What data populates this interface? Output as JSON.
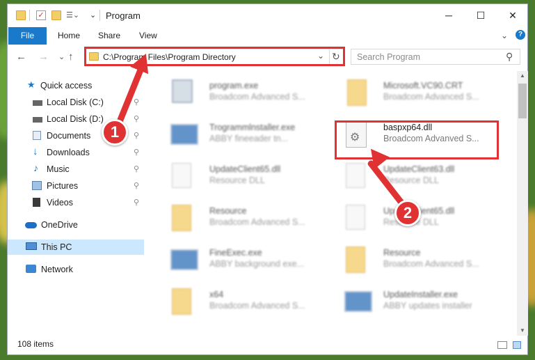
{
  "window": {
    "title": "Program",
    "controls": {
      "minimize": "─",
      "maximize": "☐",
      "close": "✕"
    }
  },
  "ribbon": {
    "tabs": [
      "File",
      "Home",
      "Share",
      "View"
    ],
    "collapse_glyph": "⌄",
    "help_glyph": "?"
  },
  "navigation": {
    "back": "←",
    "forward": "→",
    "recent": "⌄",
    "up": "↑",
    "address": "C:\\Program Files\\Program Directory",
    "refresh": "↻",
    "dropdown": "⌄",
    "search_placeholder": "Search Program",
    "search_icon": "⚲"
  },
  "sidebar": {
    "quick_access": "Quick access",
    "items": [
      {
        "label": "Local Disk (C:)",
        "icon": "drive-icon"
      },
      {
        "label": "Local Disk (D:)",
        "icon": "drive-icon"
      },
      {
        "label": "Documents",
        "icon": "documents-icon"
      },
      {
        "label": "Downloads",
        "icon": "downloads-icon"
      },
      {
        "label": "Music",
        "icon": "music-icon"
      },
      {
        "label": "Pictures",
        "icon": "pictures-icon"
      },
      {
        "label": "Videos",
        "icon": "videos-icon"
      }
    ],
    "onedrive": "OneDrive",
    "this_pc": "This PC",
    "network": "Network",
    "pin_glyph": "📌"
  },
  "files": [
    {
      "name": "program.exe",
      "desc": "Broadcom Advanced S...",
      "kind": "exe"
    },
    {
      "name": "Microsoft.VC90.CRT",
      "desc": "Broadcom Advanced S...",
      "kind": "folder"
    },
    {
      "name": "Trogrammlnstaller.exe",
      "desc": "ABBY fineeader tn...",
      "kind": "exe"
    },
    {
      "name": "baspxp64.dll",
      "desc": "Broadcom Advanved S...",
      "kind": "dll"
    },
    {
      "name": "UpdateClient65.dll",
      "desc": "Resource DLL",
      "kind": "dll"
    },
    {
      "name": "UpdateClient63.dll",
      "desc": "Resource DLL",
      "kind": "dll"
    },
    {
      "name": "Resource",
      "desc": "Broadcom Advanced S...",
      "kind": "folder"
    },
    {
      "name": "UpdateClient65.dll",
      "desc": "Resource DLL",
      "kind": "dll"
    },
    {
      "name": "FineExec.exe",
      "desc": "ABBY background exe...",
      "kind": "exe"
    },
    {
      "name": "Resource",
      "desc": "Broadcom Advanced S...",
      "kind": "folder"
    },
    {
      "name": "x64",
      "desc": "Broadcom Advanced S...",
      "kind": "folder"
    },
    {
      "name": "UpdateInstaller.exe",
      "desc": "ABBY updates installer",
      "kind": "exe"
    }
  ],
  "status": {
    "count": "108 items"
  },
  "annotations": {
    "step1": "1",
    "step2": "2"
  },
  "colors": {
    "accent": "#1979ca",
    "annotation_red": "#e03232"
  }
}
